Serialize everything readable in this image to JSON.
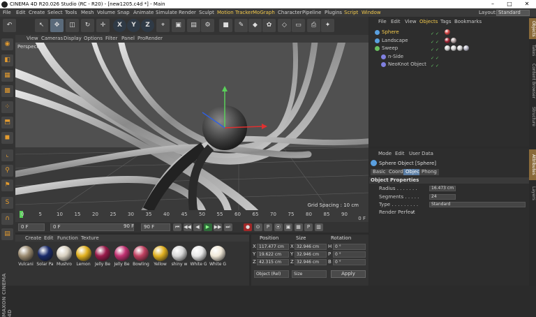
{
  "window": {
    "title": "CINEMA 4D R20.026 Studio (RC - R20) - [new1205.c4d *] - Main",
    "controls": [
      "–",
      "□",
      "✕"
    ]
  },
  "menubar": {
    "items": [
      "File",
      "Edit",
      "Create",
      "Select",
      "Tools",
      "Mesh",
      "Volume",
      "Snap",
      "Animate",
      "Simulate",
      "Render",
      "Sculpt",
      "Motion Tracker",
      "MoGraph",
      "Character",
      "Pipeline",
      "Plugins",
      "Script",
      "Window"
    ],
    "highlighted": [
      "Motion Tracker",
      "Script"
    ],
    "layout_label": "Layout:",
    "layout_value": "Standard"
  },
  "toolbar": {
    "buttons": [
      {
        "icon": "undo-icon",
        "glyph": "↶"
      },
      {
        "icon": "select-icon",
        "glyph": "↖"
      },
      {
        "icon": "move-icon",
        "glyph": "✥"
      },
      {
        "icon": "scale-icon",
        "glyph": "◫"
      },
      {
        "icon": "rotate-icon",
        "glyph": "↻"
      },
      {
        "icon": "recent-tool-icon",
        "glyph": "✛"
      },
      {
        "icon": "x-axis-icon",
        "glyph": "X"
      },
      {
        "icon": "y-axis-icon",
        "glyph": "Y"
      },
      {
        "icon": "z-axis-icon",
        "glyph": "Z"
      },
      {
        "icon": "coordinate-system-icon",
        "glyph": "⌖"
      },
      {
        "icon": "render-view-icon",
        "glyph": "▣"
      },
      {
        "icon": "render-picture-viewer-icon",
        "glyph": "▤"
      },
      {
        "icon": "render-settings-icon",
        "glyph": "⚙"
      },
      {
        "icon": "cube-icon",
        "glyph": "■"
      },
      {
        "icon": "pen-icon",
        "glyph": "✎"
      },
      {
        "icon": "subdivision-icon",
        "glyph": "◆"
      },
      {
        "icon": "array-icon",
        "glyph": "✿"
      },
      {
        "icon": "deformer-icon",
        "glyph": "◇"
      },
      {
        "icon": "floor-icon",
        "glyph": "▭"
      },
      {
        "icon": "camera-icon",
        "glyph": "⎙"
      },
      {
        "icon": "light-icon",
        "glyph": "✦"
      }
    ]
  },
  "left_tools": [
    {
      "icon": "make-editable-icon",
      "glyph": "◉"
    },
    {
      "icon": "model-mode-icon",
      "glyph": "◧"
    },
    {
      "icon": "texture-mode-icon",
      "glyph": "▦"
    },
    {
      "icon": "workplane-icon",
      "glyph": "▩"
    },
    {
      "icon": "points-mode-icon",
      "glyph": "⁘"
    },
    {
      "icon": "edges-mode-icon",
      "glyph": "⬒"
    },
    {
      "icon": "polygons-mode-icon",
      "glyph": "◼"
    },
    {
      "icon": "axis-mode-icon",
      "glyph": "⌞"
    },
    {
      "icon": "tweak-icon",
      "glyph": "⚲"
    },
    {
      "icon": "snap-icon",
      "glyph": "⚑"
    },
    {
      "icon": "solo-icon",
      "glyph": "S"
    },
    {
      "icon": "magnet-icon",
      "glyph": "∩"
    },
    {
      "icon": "grid-icon",
      "glyph": "▤"
    }
  ],
  "maxon_logo": "MAXON CINEMA 4D",
  "viewport": {
    "menu": [
      "View",
      "Cameras",
      "Display",
      "Options",
      "Filter",
      "Panel",
      "ProRender"
    ],
    "label": "Perspective",
    "grid_spacing": "Grid Spacing : 10 cm"
  },
  "timeline": {
    "ticks": [
      "0",
      "5",
      "10",
      "15",
      "20",
      "25",
      "30",
      "35",
      "40",
      "45",
      "50",
      "55",
      "60",
      "65",
      "70",
      "75",
      "80",
      "85",
      "90"
    ],
    "end_label": "0 F"
  },
  "playback": {
    "start": "0 F",
    "current": "0 F",
    "end_a": "90 F",
    "end_b": "90 F",
    "buttons": [
      "⏮",
      "◀◀",
      "◀",
      "▶",
      "▶▶",
      "⏭",
      "●",
      "⊙",
      "P",
      "⦿",
      "▣",
      "▦",
      "P",
      "▥"
    ]
  },
  "materials": {
    "menu": [
      "Create",
      "Edit",
      "Function",
      "Texture"
    ],
    "items": [
      {
        "name": "Vulcani",
        "color": "#9a8a70"
      },
      {
        "name": "Solar Pa",
        "color": "#1a2a6a"
      },
      {
        "name": "Mushro",
        "color": "#d8d0c0"
      },
      {
        "name": "Lemon",
        "color": "#e0b020"
      },
      {
        "name": "Jelly Be",
        "color": "#9a1a4a"
      },
      {
        "name": "Jelly Be",
        "color": "#c03070"
      },
      {
        "name": "Bowling",
        "color": "#c04060"
      },
      {
        "name": "Yellow",
        "color": "#e0b020"
      },
      {
        "name": "shiny w",
        "color": "#d8d8d8"
      },
      {
        "name": "White G",
        "color": "#e8e8e8"
      },
      {
        "name": "White G",
        "color": "#f0e8d8"
      }
    ]
  },
  "coordinates": {
    "headers": [
      "Position",
      "Size",
      "Rotation"
    ],
    "rows": [
      {
        "axis": "X",
        "pos": "117.477 cm",
        "size": "32.946 cm",
        "rot_label": "H",
        "rot": "0 °"
      },
      {
        "axis": "Y",
        "pos": "19.622 cm",
        "size": "32.946 cm",
        "rot_label": "P",
        "rot": "0 °"
      },
      {
        "axis": "Z",
        "pos": "42.315 cm",
        "size": "32.946 cm",
        "rot_label": "B",
        "rot": "0 °"
      }
    ],
    "mode": "Object (Rel)",
    "size_mode": "Size",
    "apply": "Apply"
  },
  "objects": {
    "menu": [
      "File",
      "Edit",
      "View",
      "Objects",
      "Tags",
      "Bookmarks"
    ],
    "active_tab": "Objects",
    "items": [
      {
        "name": "Sphere",
        "indent": 0,
        "color": "#f2c94c",
        "icon_color": "#5aa0e0",
        "tags": [
          "#d04040"
        ]
      },
      {
        "name": "Landscape",
        "indent": 0,
        "color": "#c8c8c8",
        "icon_color": "#5aa0e0",
        "tags": [
          "#a02030",
          "#b0a0a0"
        ]
      },
      {
        "name": "Sweep",
        "indent": 0,
        "color": "#c8c8c8",
        "icon_color": "#6ac060",
        "tags": [
          "#d0d0d0",
          "#d0d0d0",
          "#d0d0d0",
          "#b0b0c0"
        ]
      },
      {
        "name": "n-Side",
        "indent": 1,
        "color": "#c8c8c8",
        "icon_color": "#8080e0",
        "tags": []
      },
      {
        "name": "NeoKnot Object",
        "indent": 1,
        "color": "#c8c8c8",
        "icon_color": "#8080e0",
        "tags": []
      }
    ]
  },
  "attributes": {
    "menu": [
      "Mode",
      "Edit",
      "User Data"
    ],
    "object_title": "Sphere Object [Sphere]",
    "tabs": [
      "Basic",
      "Coord.",
      "Object",
      "Phong"
    ],
    "active_tab": "Object",
    "section": "Object Properties",
    "radius_label": "Radius . . . . . . .",
    "radius_value": "16.473 cm",
    "segments_label": "Segments . . . . .",
    "segments_value": "24",
    "type_label": "Type . . . . . . . . .",
    "type_value": "Standard",
    "render_perfect_label": "Render Perfect",
    "render_perfect_value": "✓"
  },
  "side_tabs": [
    "Objects",
    "Takes",
    "Content Browser",
    "Structure",
    "Attributes",
    "Layers"
  ],
  "active_side_tabs": [
    "Objects",
    "Attributes"
  ]
}
